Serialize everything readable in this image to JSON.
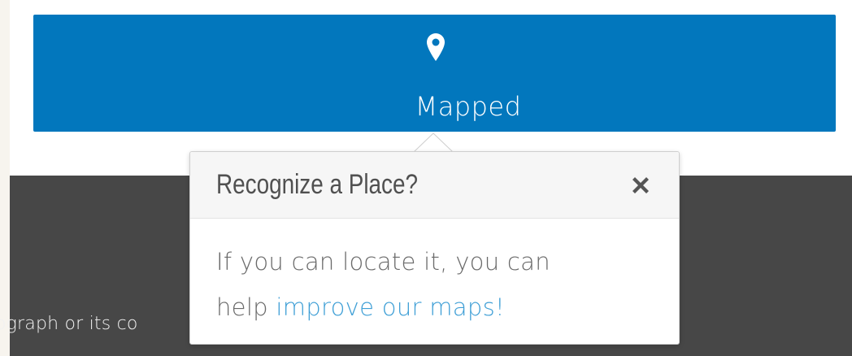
{
  "button": {
    "label": "Mapped",
    "icon": "map-pin-icon",
    "color": "#0277bd"
  },
  "popover": {
    "title": "Recognize a Place?",
    "close_icon": "close-icon",
    "body_line1": "If you can locate it, you can",
    "body_prefix": "help ",
    "link_text": "improve our maps!"
  },
  "background": {
    "caption_fragment": "ograph or its co"
  },
  "colors": {
    "link": "#3f9fd6",
    "dark_band": "#474747",
    "header_bg": "#f6f6f6"
  }
}
